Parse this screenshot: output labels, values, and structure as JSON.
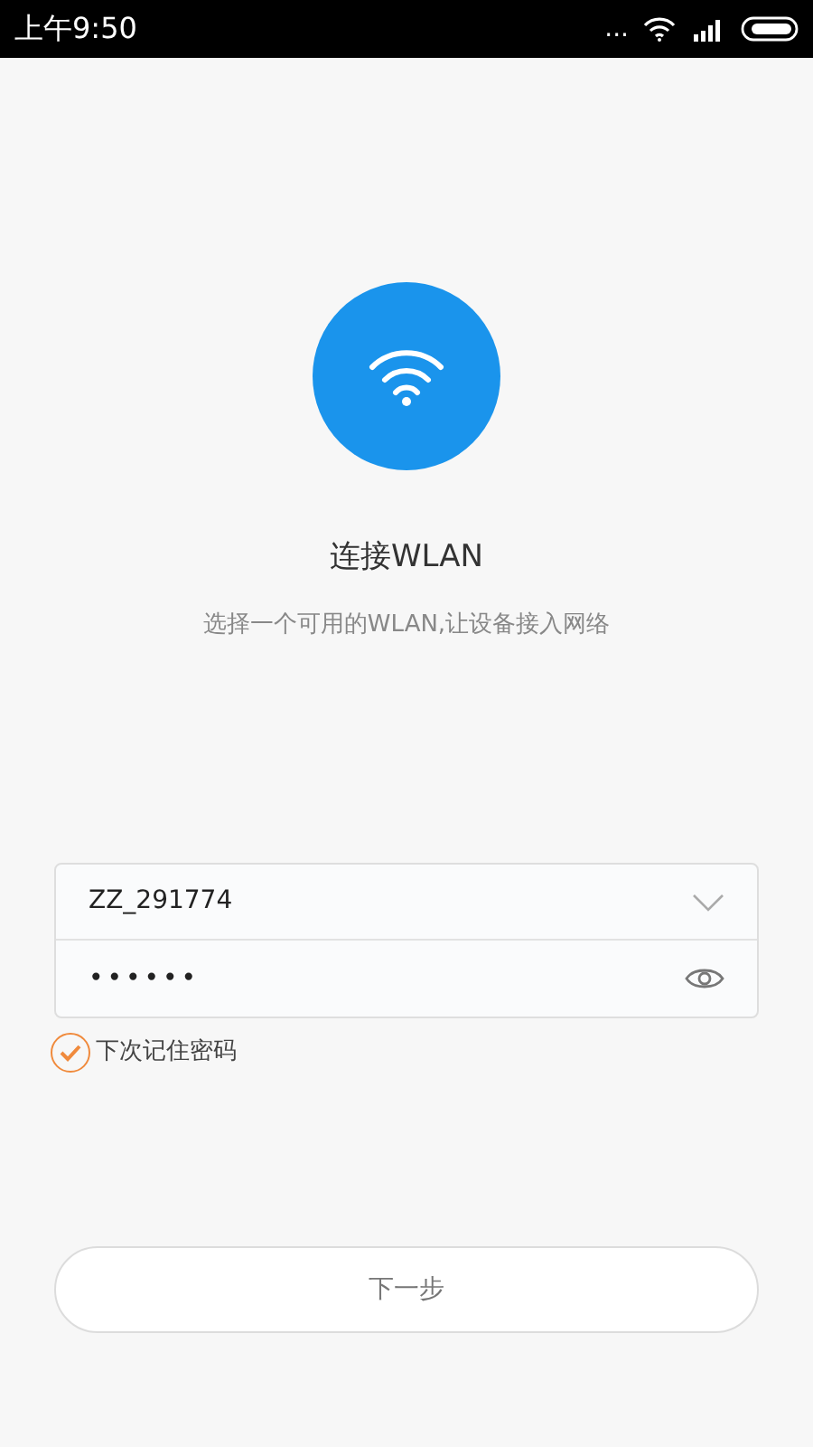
{
  "status_bar": {
    "time": "上午9:50",
    "more": "..."
  },
  "header": {
    "title": "连接WLAN",
    "subtitle": "选择一个可用的WLAN,让设备接入网络"
  },
  "form": {
    "network": {
      "value": "ZZ_291774"
    },
    "password": {
      "value": "••••••"
    },
    "remember": {
      "label": "下次记住密码",
      "checked": true
    }
  },
  "next_button": {
    "label": "下一步"
  }
}
